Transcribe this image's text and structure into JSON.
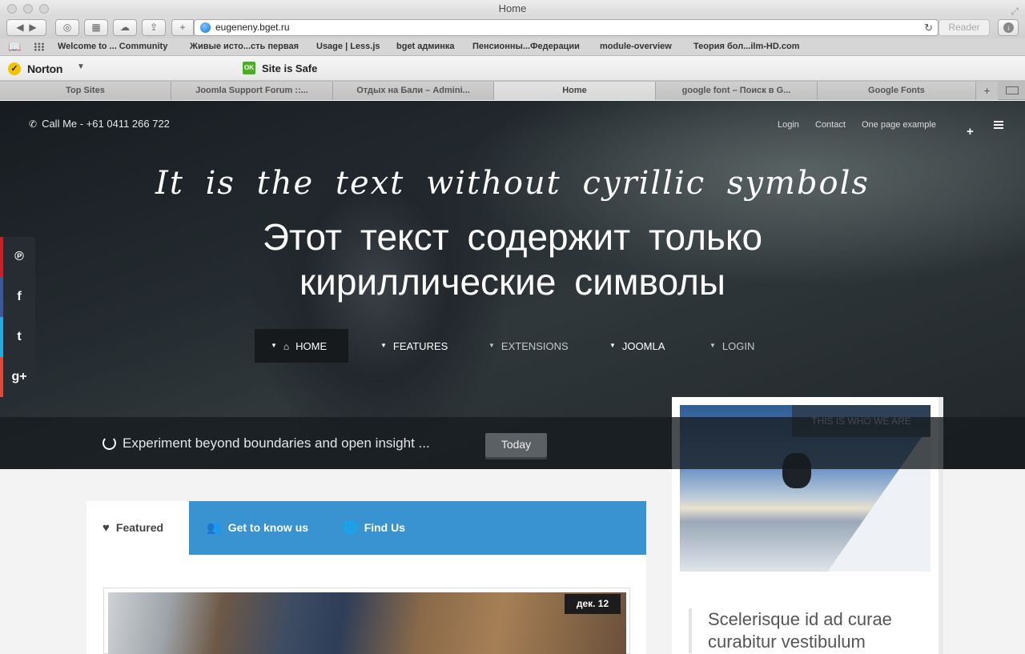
{
  "window": {
    "title": "Home"
  },
  "browser": {
    "url": "eugeneny.bget.ru",
    "reader_label": "Reader",
    "bookmarks": [
      "Welcome to ... Community",
      "Живые исто...сть первая",
      "Usage | Less.js",
      "bget админка",
      "Пенсионны...Федерации",
      "module-overview",
      "Теория бол...ilm-HD.com"
    ],
    "norton": {
      "logo": "Norton",
      "ok_badge": "OK",
      "status": "Site is Safe"
    },
    "tabs": [
      "Top Sites",
      "Joomla Support Forum ::...",
      "Отдых на Бали – Admini...",
      "Home",
      "google font – Поиск в G...",
      "Google Fonts"
    ],
    "new_tab": "+"
  },
  "header": {
    "call_me": "Call Me - +61 0411 266 722",
    "links": [
      "Login",
      "Contact",
      "One page example"
    ],
    "plus": "+"
  },
  "hero": {
    "script_text": "It is the text without cyrillic symbols",
    "title": "Этот текст содержит только кириллические символы"
  },
  "nav": [
    {
      "label": "HOME"
    },
    {
      "label": "FEATURES"
    },
    {
      "label": "EXTENSIONS"
    },
    {
      "label": "JOOMLA"
    },
    {
      "label": "LOGIN"
    }
  ],
  "social": [
    {
      "glyph": "℗",
      "color": "#cb2027"
    },
    {
      "glyph": "f",
      "color": "#3b5998"
    },
    {
      "glyph": "t",
      "color": "#2aa9e0"
    },
    {
      "glyph": "g+",
      "color": "#dd4b39"
    }
  ],
  "ticker": {
    "text": "Experiment beyond boundaries and open insight ...",
    "button": "Today"
  },
  "content_tabs": [
    {
      "label": "Featured",
      "icon": "heart-icon"
    },
    {
      "label": "Get to know us",
      "icon": "users-icon"
    },
    {
      "label": "Find Us",
      "icon": "globe-icon"
    }
  ],
  "article": {
    "date": "дек. 12"
  },
  "side": {
    "label": "THIS IS WHO WE ARE",
    "quote": "Scelerisque id ad curae curabitur vestibulum"
  },
  "colors": {
    "accent_blue": "#3a93d1",
    "nav_active": "#161a1d"
  }
}
